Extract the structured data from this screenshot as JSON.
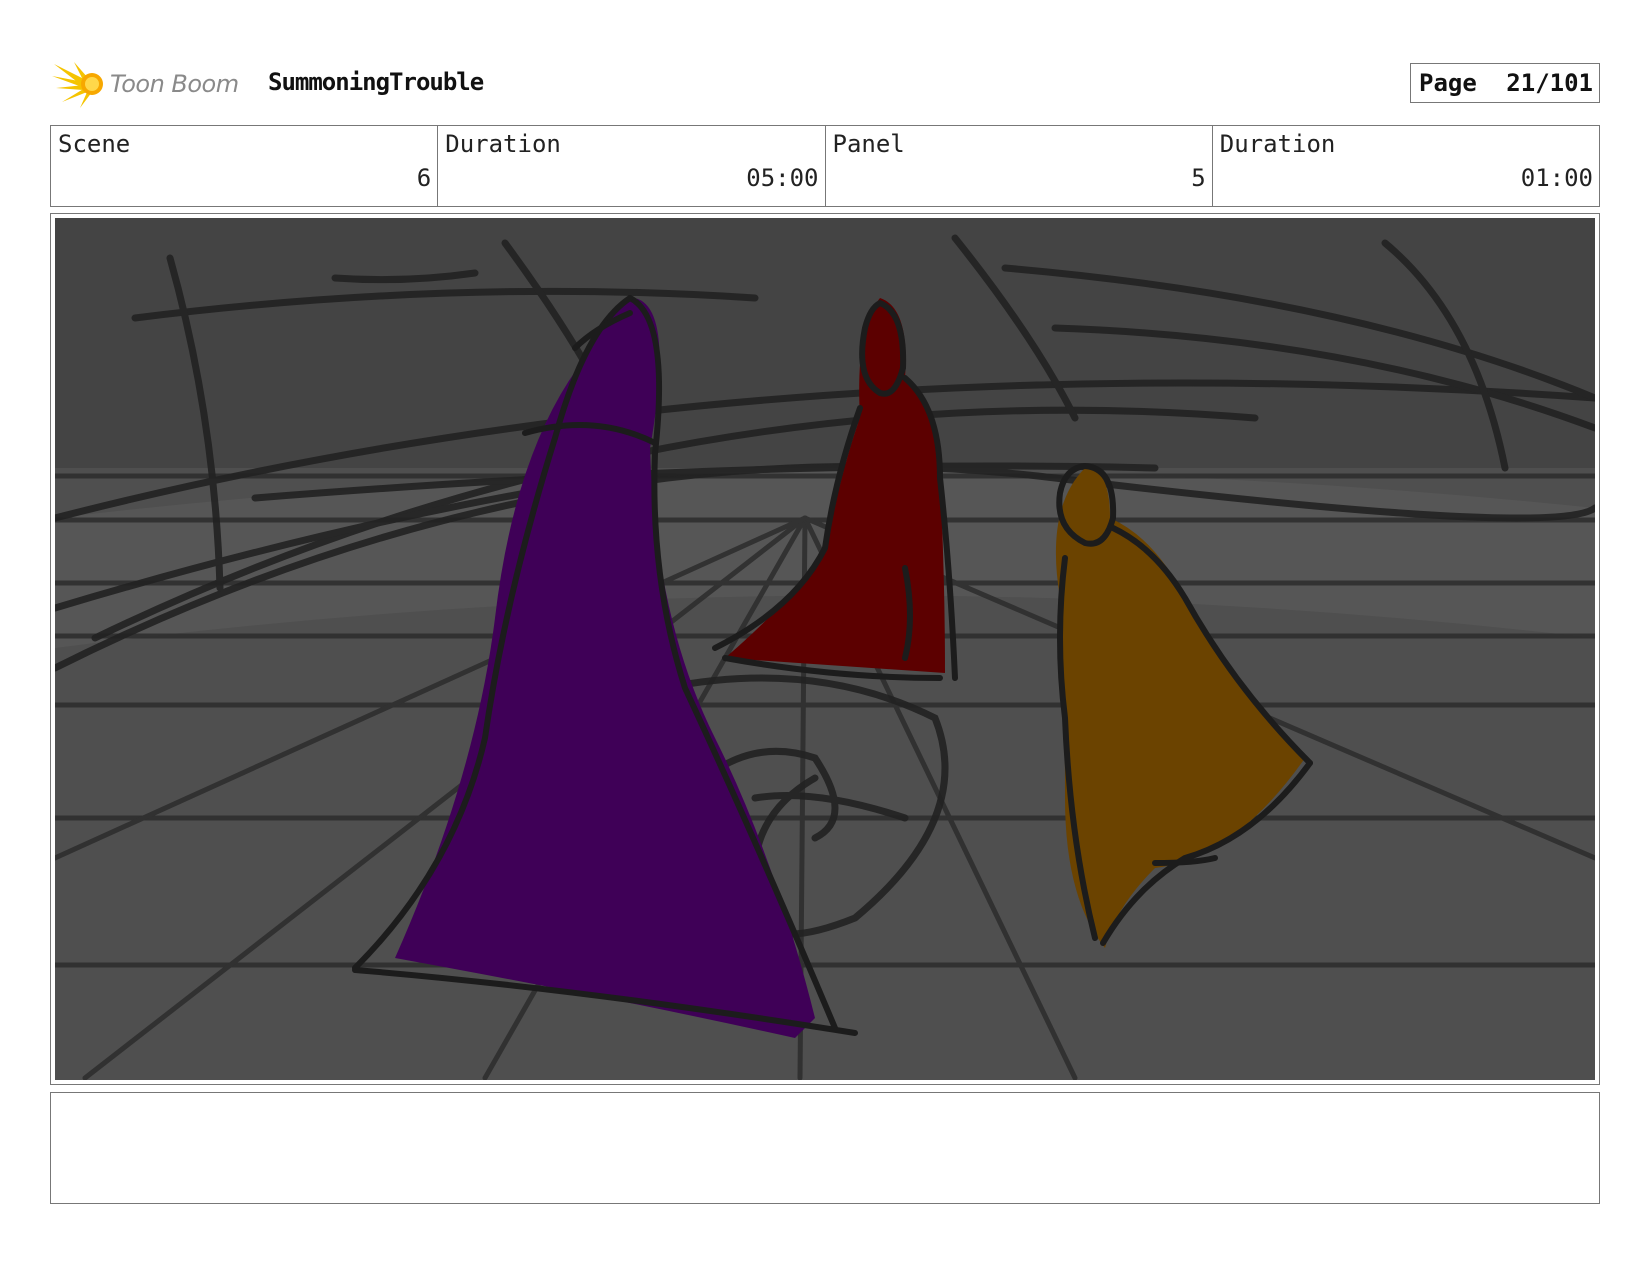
{
  "header": {
    "logo_text": "Toon Boom",
    "project_title": "SummoningTrouble",
    "page_label": "Page",
    "page_value": "21/101"
  },
  "info": {
    "scene_label": "Scene",
    "scene_value": "6",
    "scene_duration_label": "Duration",
    "scene_duration_value": "05:00",
    "panel_label": "Panel",
    "panel_value": "5",
    "panel_duration_label": "Duration",
    "panel_duration_value": "01:00"
  },
  "colors": {
    "background": "#4f4f4f",
    "purple_robe": "#3f0057",
    "red_robe": "#5c0000",
    "orange_robe": "#6b4300",
    "logo_yellow": "#f5c400"
  }
}
